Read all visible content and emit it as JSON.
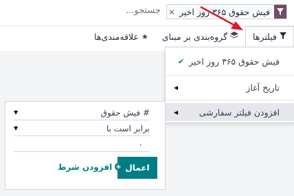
{
  "search": {
    "placeholder": "جستجو...",
    "facet_label": "فیش حقوق ۳۶۵ روز اخیر",
    "facet_close": "×"
  },
  "tabs": {
    "filters": "فیلترها",
    "group_by": "گروه‌بندی بر مبنای",
    "favorites": "علاقه‌مندی‌ها"
  },
  "dropdown": {
    "items": [
      {
        "label": "فیش حقوق ۳۶۵ روز اخیر",
        "checked": true
      },
      {
        "label": "تاریخ آغاز",
        "submenu": true
      },
      {
        "label": "افزودن فیلتر سفارشی",
        "submenu": true,
        "highlighted": true
      }
    ]
  },
  "custom_filter": {
    "field": "# فیش حقوق",
    "operator": "برابر است با",
    "value": "۰",
    "apply_label": "اعمال",
    "add_condition_label": "افزودن شرط"
  },
  "colors": {
    "primary": "#017e84",
    "facet_icon_bg": "#714b67",
    "arrow": "#e0182d"
  }
}
